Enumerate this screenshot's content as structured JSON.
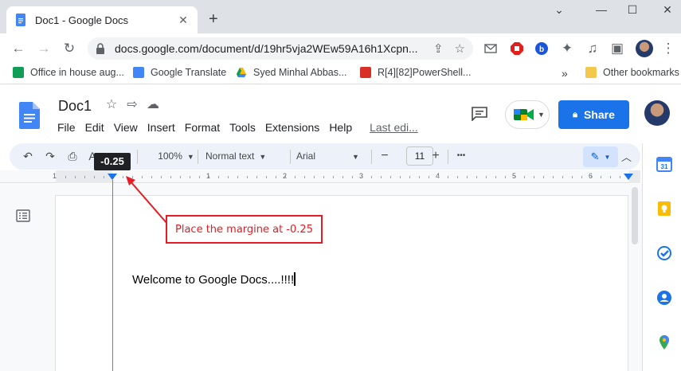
{
  "browser": {
    "tab_title": "Doc1 - Google Docs",
    "tab_close": "✕",
    "new_tab": "+",
    "window_controls": [
      "⌄",
      "—",
      "☐",
      "✕"
    ],
    "url": "docs.google.com/document/d/19hr5vja2WEw59A16h1Xcpn...",
    "bookmarks": [
      {
        "label": "Office in house aug...",
        "icon": "sheets-icon"
      },
      {
        "label": "Google Translate",
        "icon": "translate-icon"
      },
      {
        "label": "Syed Minhal Abbas...",
        "icon": "drive-icon"
      },
      {
        "label": "R[4][82]PowerShell...",
        "icon": "bookmark-red-icon"
      }
    ],
    "more_bookmarks": "»",
    "other_bookmarks": "Other bookmarks"
  },
  "docs": {
    "title": "Doc1",
    "menu": [
      "File",
      "Edit",
      "View",
      "Insert",
      "Format",
      "Tools",
      "Extensions",
      "Help"
    ],
    "last_edit": "Last edi...",
    "share_label": "Share",
    "toolbar": {
      "zoom": "100%",
      "style": "Normal text",
      "font": "Arial",
      "font_size": "11",
      "minus": "−",
      "plus": "+",
      "more": "•••"
    },
    "ruler_numbers": [
      "1",
      "1",
      "2",
      "3",
      "4",
      "5",
      "6"
    ],
    "margin_tooltip": "-0.25",
    "body_text": "Welcome to Google Docs....!!!!"
  },
  "annotation": {
    "text": "Place the margine at -0.25",
    "color": "#e51c23"
  },
  "colors": {
    "accent": "#1a73e8",
    "tabstrip": "#dee1e6",
    "toolbar_bg": "#edf2fa"
  }
}
